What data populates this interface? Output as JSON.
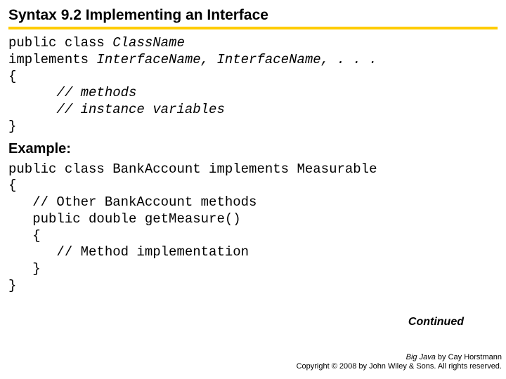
{
  "title": "Syntax 9.2 Implementing an Interface",
  "syntax": {
    "l1a": "public class ",
    "l1b": "ClassName",
    "l2a": "implements ",
    "l2b": "InterfaceName, InterfaceName, . . .",
    "l3": "{",
    "l4": "      // methods",
    "l5": "      // instance variables",
    "l6": "}"
  },
  "example_label": "Example:",
  "example": {
    "l1": "public class BankAccount implements Measurable",
    "l2": "{",
    "l3": "   // Other BankAccount methods",
    "l4": "   public double getMeasure()",
    "l5": "   {",
    "l6": "      // Method implementation",
    "l7": "   }",
    "l8": "}"
  },
  "continued": "Continued",
  "footer": {
    "book": "Big Java",
    "author": " by Cay Horstmann",
    "copyright": "Copyright © 2008 by John Wiley & Sons. All rights reserved."
  }
}
